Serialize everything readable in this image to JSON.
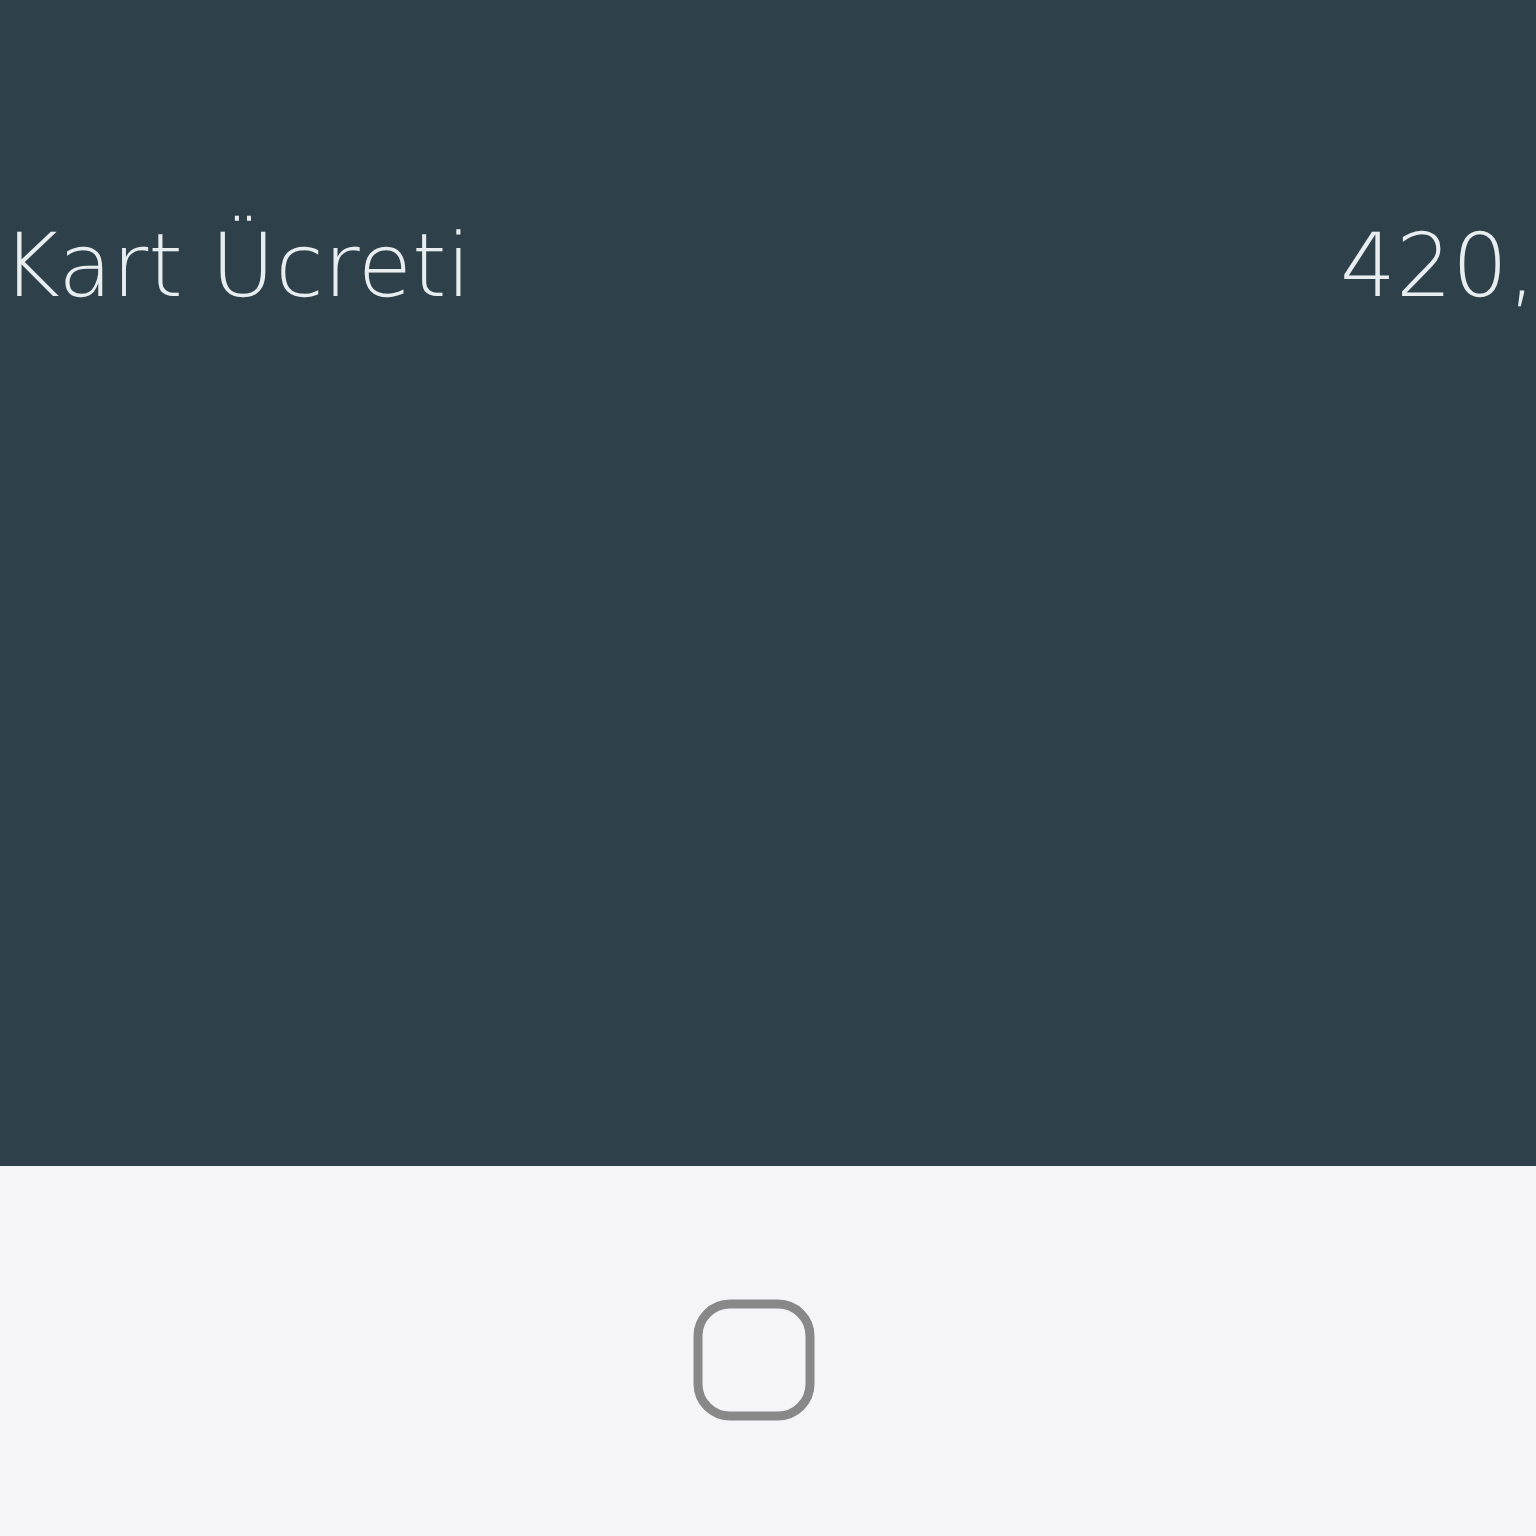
{
  "fee_row": {
    "label": "Kart Ücreti",
    "amount": "420,"
  }
}
